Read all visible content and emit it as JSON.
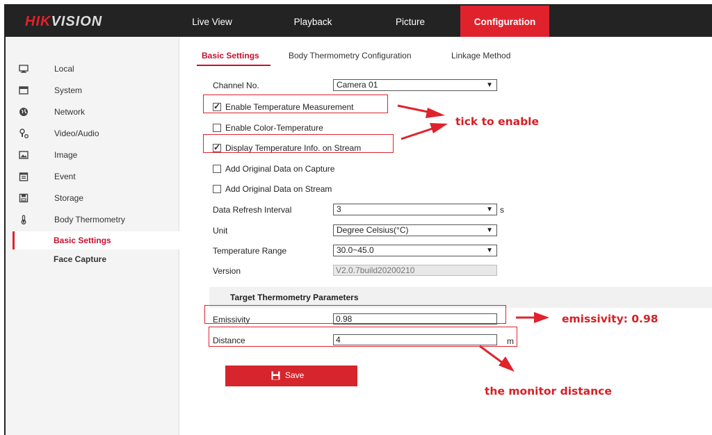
{
  "logo": {
    "part1": "HIK",
    "part2": "VISION"
  },
  "nav": {
    "tabs": [
      {
        "label": "Live View"
      },
      {
        "label": "Playback"
      },
      {
        "label": "Picture"
      },
      {
        "label": "Configuration",
        "active": true
      }
    ]
  },
  "sidebar": {
    "items": [
      {
        "label": "Local",
        "icon": "monitor-icon"
      },
      {
        "label": "System",
        "icon": "system-icon"
      },
      {
        "label": "Network",
        "icon": "globe-icon"
      },
      {
        "label": "Video/Audio",
        "icon": "video-audio-icon"
      },
      {
        "label": "Image",
        "icon": "image-icon"
      },
      {
        "label": "Event",
        "icon": "calendar-icon"
      },
      {
        "label": "Storage",
        "icon": "storage-icon"
      },
      {
        "label": "Body Thermometry",
        "icon": "thermometer-icon"
      }
    ],
    "subitems": [
      {
        "label": "Basic Settings",
        "active": true
      },
      {
        "label": "Face Capture"
      }
    ]
  },
  "subtabs": [
    {
      "label": "Basic Settings",
      "active": true
    },
    {
      "label": "Body Thermometry Configuration"
    },
    {
      "label": "Linkage Method"
    }
  ],
  "form": {
    "channel": {
      "label": "Channel No.",
      "value": "Camera 01"
    },
    "enable_temp": {
      "label": "Enable Temperature Measurement",
      "checked": true
    },
    "enable_color": {
      "label": "Enable Color-Temperature",
      "checked": false
    },
    "display_temp": {
      "label": "Display Temperature Info. on Stream",
      "checked": true
    },
    "add_capture": {
      "label": "Add Original Data on Capture",
      "checked": false
    },
    "add_stream": {
      "label": "Add Original Data on Stream",
      "checked": false
    },
    "refresh": {
      "label": "Data Refresh Interval",
      "value": "3",
      "unit": "s"
    },
    "unit": {
      "label": "Unit",
      "value": "Degree Celsius(°C)"
    },
    "range": {
      "label": "Temperature Range",
      "value": "30.0~45.0"
    },
    "version": {
      "label": "Version",
      "value": "V2.0.7build20200210"
    },
    "target_heading": "Target Thermometry Parameters",
    "emissivity": {
      "label": "Emissivity",
      "value": "0.98"
    },
    "distance": {
      "label": "Distance",
      "value": "4",
      "unit": "m"
    },
    "save_label": "Save"
  },
  "annotations": {
    "tick": "tick to enable",
    "emissivity": "emissivity:  0.98",
    "distance": "the monitor distance",
    "color": "#d61f26"
  },
  "colors": {
    "accent": "#e0222c",
    "topbar": "#232323"
  }
}
